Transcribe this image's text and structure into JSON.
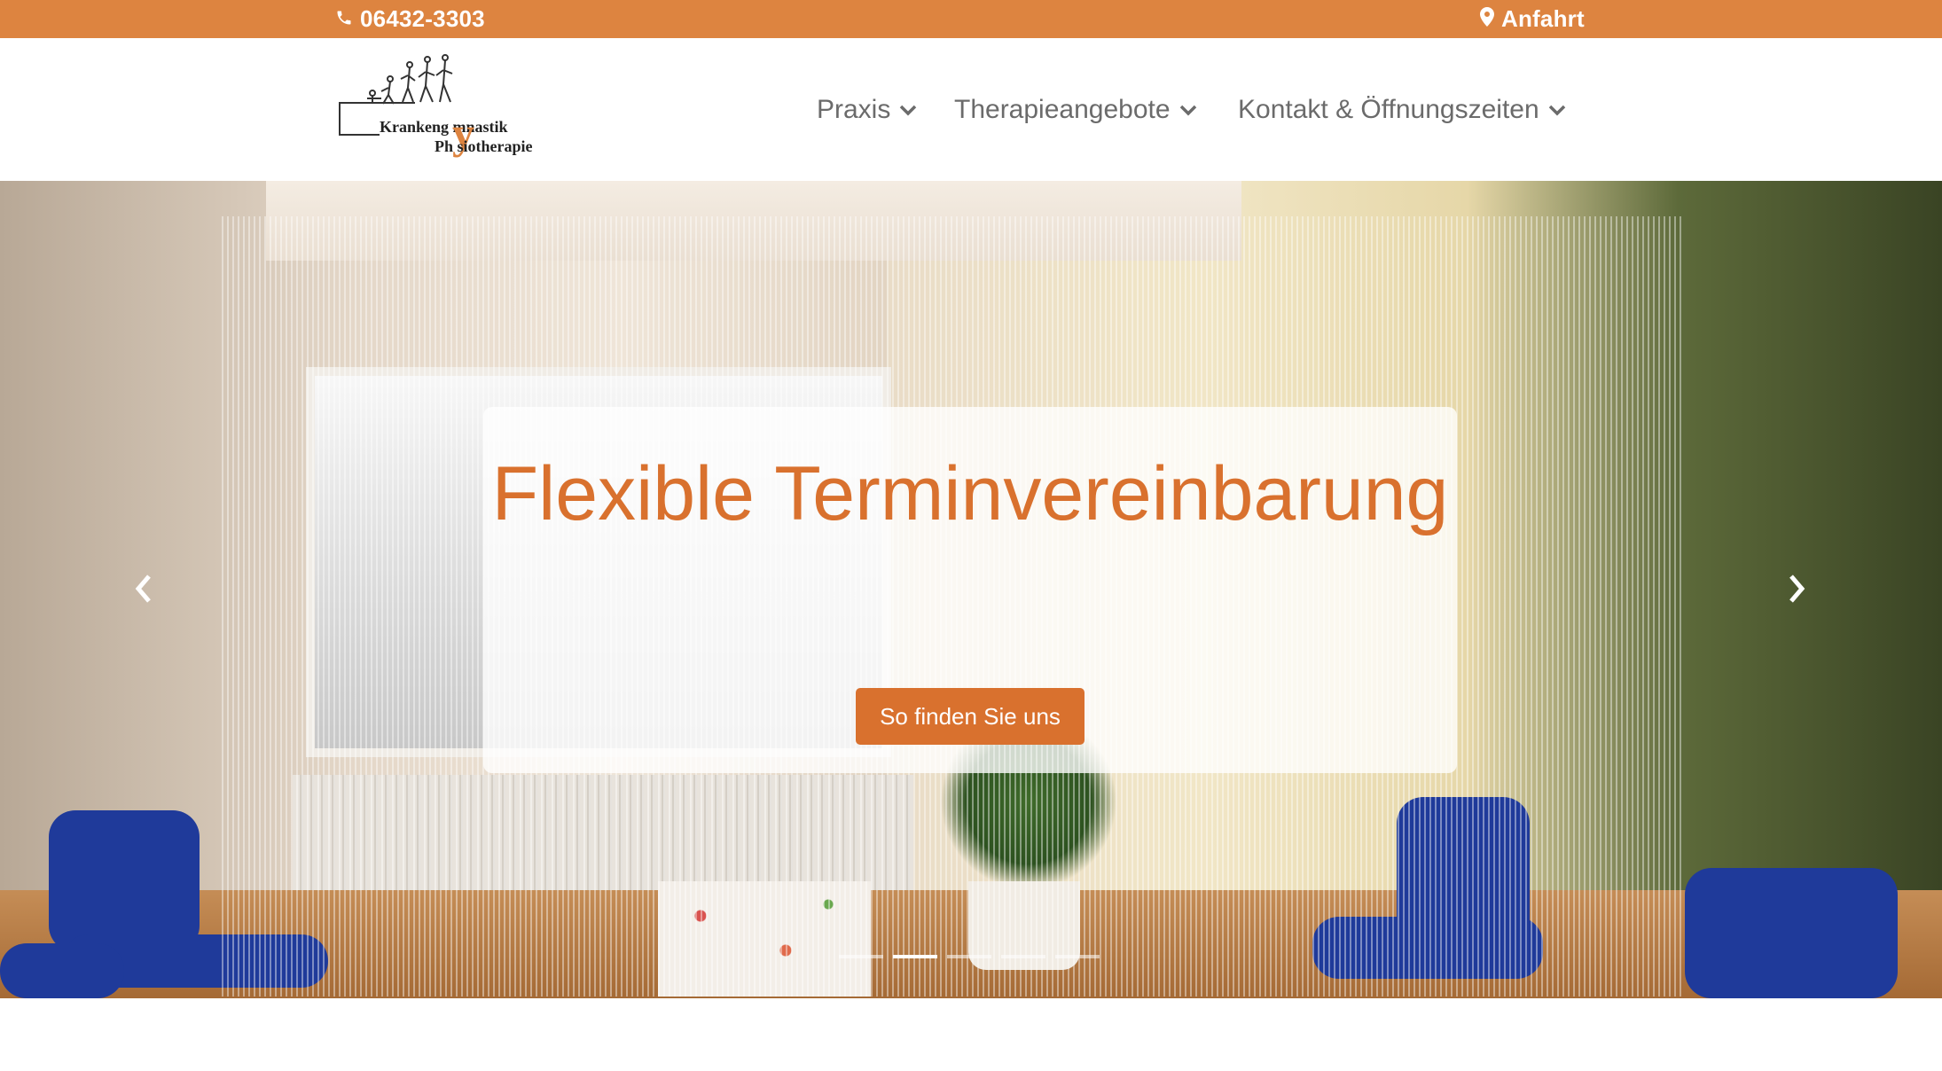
{
  "topbar": {
    "phone": "06432-3303",
    "directions": "Anfahrt",
    "background_color": "#dd8440"
  },
  "logo": {
    "line1": "Krankeng  mnastik",
    "line2": "Ph    siotherapie",
    "accent_letter": "y",
    "accent_color": "#dd8440"
  },
  "nav": {
    "items": [
      {
        "label": "Praxis",
        "icon": "chevron-down-icon"
      },
      {
        "label": "Therapieangebote",
        "icon": "chevron-down-icon"
      },
      {
        "label": "Kontakt & Öffnungszeiten",
        "icon": "chevron-down-icon"
      }
    ]
  },
  "hero": {
    "title": "Flexible Terminvereinbarung",
    "button_label": "So finden Sie uns",
    "accent_color": "#d9712e",
    "slides_count": 5,
    "active_slide": 2,
    "prev_icon": "chevron-left-icon",
    "next_icon": "chevron-right-icon"
  }
}
